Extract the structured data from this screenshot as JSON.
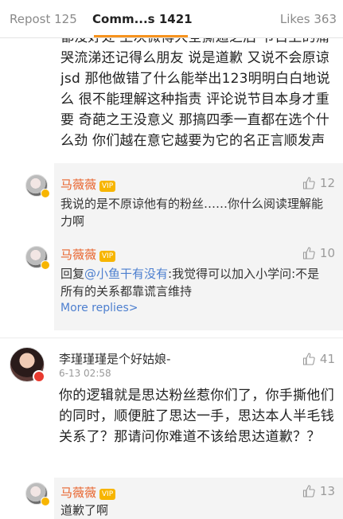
{
  "tabs": {
    "repost": "Repost 125",
    "comments": "Comm...s 1421",
    "likes": "Likes 363"
  },
  "main_comment_1": {
    "text": "都没好处 上次微博大全撕遁之后 节目上的痛哭流涕还记得么朋友 说是道歉 又说不会原谅jsd 那他做错了什么能举出123明明白白地说么 很不能理解这种指责 评论说节目本身才重要 奇葩之王没意义 那搞四季一直都在选个什么劲 你们越在意它越要为它的名正言顺发声"
  },
  "replies_1": [
    {
      "name": "马薇薇",
      "badge": "VIP",
      "likes": "12",
      "text": "我说的是不原谅他有的粉丝……你什么阅读理解能力啊"
    },
    {
      "name": "马薇薇",
      "badge": "VIP",
      "likes": "10",
      "prefix": "回复",
      "mention": "@小鱼干有没有",
      "text": ":我觉得可以加入小学问:不是所有的关系都靠谎言维持"
    }
  ],
  "more_replies": "More replies>",
  "main_comment_2": {
    "name": "李瑾瑾瑾是个好姑娘-",
    "time": "6-13 02:58",
    "likes": "41",
    "text": "你的逻辑就是思达粉丝惹你们了，你手撕他们的同时，顺便脏了思达一手，思达本人半毛钱关系了？那请问你难道不该给思达道歉？？"
  },
  "replies_2": [
    {
      "name": "马薇薇",
      "badge": "VIP",
      "likes": "13",
      "text": "道歉了啊"
    }
  ],
  "colors": {
    "accent": "#f7931e",
    "name": "#e8632c",
    "link": "#4d7fcf",
    "reply_bg": "#f4f4f4"
  },
  "icons": [
    "thumb-up-icon",
    "verified-badge-icon",
    "vip-badge-icon",
    "avatar"
  ]
}
